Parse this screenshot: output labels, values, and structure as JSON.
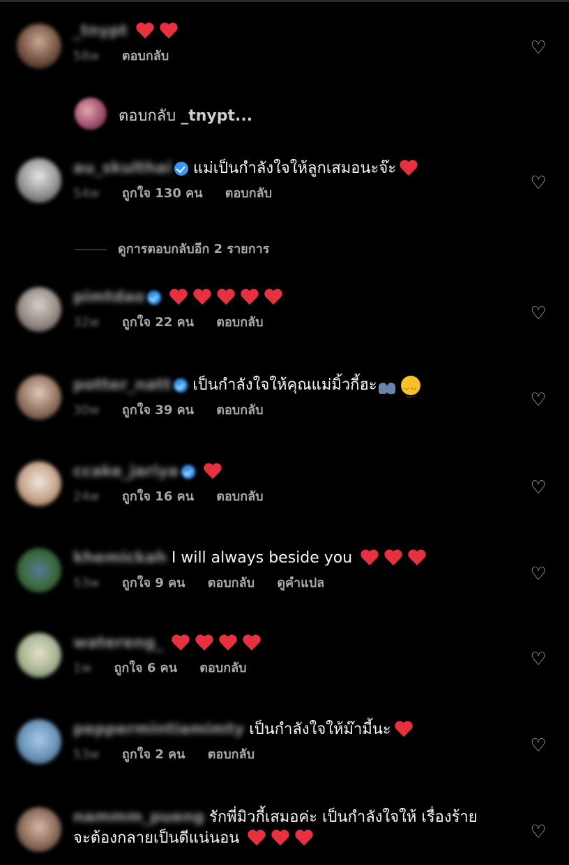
{
  "comments": [
    {
      "username": "_tnypt",
      "verified": false,
      "text": "",
      "hearts": 2,
      "time": "58w",
      "likes": "",
      "reply_label": "ตอบกลับ",
      "translate_label": ""
    },
    {
      "username": "au_skulthai",
      "verified": true,
      "text": "แม่เป็นกำลังใจให้ลูกเสมอนะจ๊ะ",
      "hearts": 1,
      "time": "54w",
      "likes": "ถูกใจ 130 คน",
      "reply_label": "ตอบกลับ",
      "translate_label": ""
    },
    {
      "username": "pimtdao",
      "verified": true,
      "text": "",
      "hearts": 5,
      "time": "32w",
      "likes": "ถูกใจ 22 คน",
      "reply_label": "ตอบกลับ",
      "translate_label": ""
    },
    {
      "username": "potter_natt",
      "verified": true,
      "text": "เป็นกำลังใจให้คุณแม่มิ้วกี้ฮะ",
      "hearts": 0,
      "time": "30w",
      "likes": "ถูกใจ 39 คน",
      "reply_label": "ตอบกลับ",
      "translate_label": ""
    },
    {
      "username": "ccake_jariya",
      "verified": true,
      "text": "",
      "hearts": 1,
      "time": "24w",
      "likes": "ถูกใจ 16 คน",
      "reply_label": "ตอบกลับ",
      "translate_label": ""
    },
    {
      "username": "khemickah",
      "verified": false,
      "text": "I will always beside you",
      "hearts": 3,
      "time": "53w",
      "likes": "ถูกใจ 9 คน",
      "reply_label": "ตอบกลับ",
      "translate_label": "ดูคำแปล"
    },
    {
      "username": "watereng_",
      "verified": false,
      "text": "",
      "hearts": 4,
      "time": "1w",
      "likes": "ถูกใจ 6 คน",
      "reply_label": "ตอบกลับ",
      "translate_label": ""
    },
    {
      "username": "peppermintiamimty",
      "verified": false,
      "text": "เป็นกำลังใจให้ม๊ามี้นะ",
      "hearts": 1,
      "time": "53w",
      "likes": "ถูกใจ 2 คน",
      "reply_label": "ตอบกลับ",
      "translate_label": ""
    },
    {
      "username": "nammm_pueng",
      "verified": false,
      "text": "รักพี่มิวกี้เสมอค่ะ เป็นกำลังใจให้ เรื่องร้ายจะต้องกลายเป็นดีแน่นอน",
      "hearts": 3,
      "time": "",
      "likes": "",
      "reply_label": "",
      "translate_label": ""
    }
  ],
  "reply_prompt": {
    "label": "ตอบกลับ",
    "target": "_tnypt..."
  },
  "view_more": "ดูการตอบกลับอีก 2 รายการ",
  "icons": {
    "like": "heart-outline-icon",
    "verified": "verified-badge-icon",
    "heart": "red-heart-emoji",
    "smile": "smiling-face-emoji",
    "hands": "raised-hands-emoji"
  },
  "colors": {
    "background": "#000000",
    "heart": "#e8313f",
    "verified": "#3897f0",
    "meta": "#a8a8a8"
  }
}
